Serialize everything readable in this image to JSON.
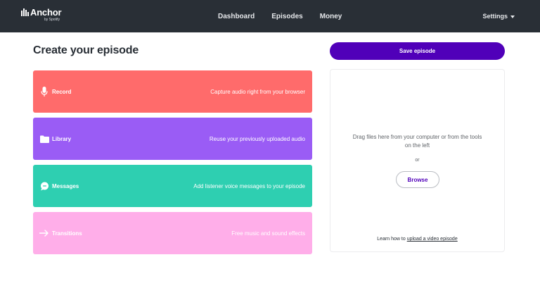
{
  "header": {
    "logo_text": "Anchor",
    "logo_subtext": "by Spotify",
    "nav": [
      {
        "label": "Dashboard"
      },
      {
        "label": "Episodes"
      },
      {
        "label": "Money"
      }
    ],
    "settings_label": "Settings"
  },
  "main": {
    "title": "Create your episode",
    "tools": [
      {
        "label": "Record",
        "description": "Capture audio right from your browser",
        "icon": "microphone-icon",
        "color": "#ff6b6b"
      },
      {
        "label": "Library",
        "description": "Reuse your previously uploaded audio",
        "icon": "folder-icon",
        "color": "#9a5cf5"
      },
      {
        "label": "Messages",
        "description": "Add listener voice messages to your episode",
        "icon": "message-bubble-icon",
        "color": "#2ecfb1"
      },
      {
        "label": "Transitions",
        "description": "Free music and sound effects",
        "icon": "arrow-right-icon",
        "color": "#ffaee9"
      }
    ]
  },
  "sidebar": {
    "save_label": "Save episode",
    "drop_text": "Drag files here from your computer or from the tools on the left",
    "or_text": "or",
    "browse_label": "Browse",
    "learn_prefix": "Learn how to ",
    "learn_link": "upload a video episode"
  },
  "colors": {
    "nav_bg": "#292f36",
    "accent_purple": "#5000b9"
  }
}
